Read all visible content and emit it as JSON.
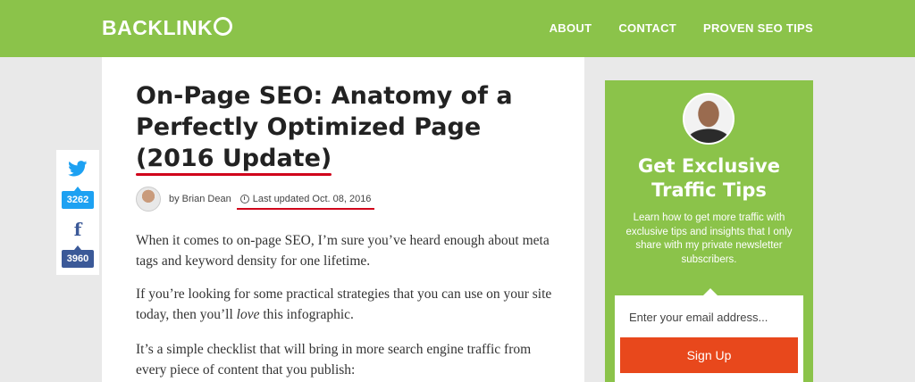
{
  "header": {
    "logo_text": "BACKLINK",
    "nav": [
      {
        "label": "ABOUT"
      },
      {
        "label": "CONTACT"
      },
      {
        "label": "PROVEN SEO TIPS"
      }
    ],
    "background": "#8bc34a"
  },
  "article": {
    "title_part1": "On-Page SEO: Anatomy of a Perfectly Optimized Page ",
    "title_part2": "(2016 Update)",
    "author": "by Brian Dean",
    "updated": "Last updated Oct. 08, 2016",
    "paragraphs": [
      "When it comes to on-page SEO, I’m sure you’ve heard enough about meta tags and keyword density for one lifetime.",
      "If you’re looking for some practical strategies that you can use on your site today, then you’ll ",
      "It’s a simple checklist that will bring in more search engine traffic from every piece of content that you publish:"
    ],
    "p2_em": "love",
    "p2_tail": " this infographic."
  },
  "share": {
    "twitter_count": "3262",
    "facebook_count": "3960",
    "twitter_color": "#1da1f2",
    "facebook_color": "#3b5998"
  },
  "sidebar": {
    "heading": "Get Exclusive Traffic Tips",
    "text": "Learn how to get more traffic with exclusive tips and insights that I only share with my private newsletter subscribers.",
    "email_placeholder": "Enter your email address...",
    "signup_label": "Sign Up",
    "signup_color": "#e8481c"
  }
}
